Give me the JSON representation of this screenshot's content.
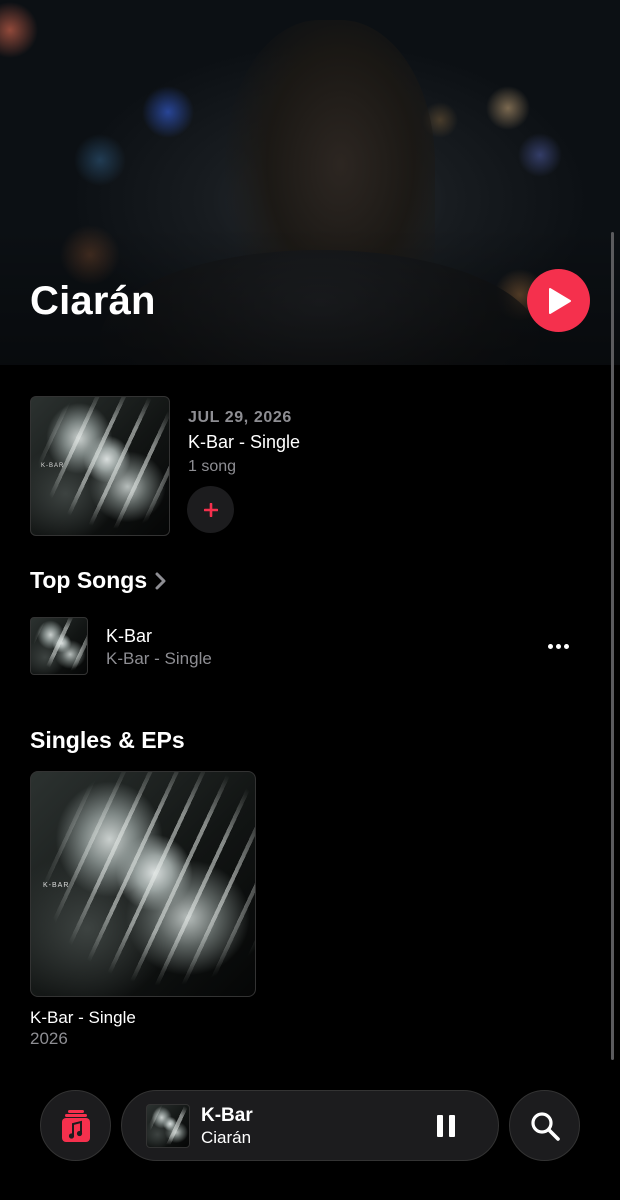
{
  "header": {
    "artist_name": "Ciarán",
    "play_icon": "play-icon",
    "accent_color": "#f5304d"
  },
  "latest_release": {
    "date": "JUL 29, 2026",
    "title": "K-Bar - Single",
    "song_count": "1 song",
    "add_icon": "plus-icon",
    "cover_text": "K-BAR"
  },
  "top_songs": {
    "heading": "Top Songs",
    "chevron_icon": "chevron-right-icon",
    "items": [
      {
        "title": "K-Bar",
        "subtitle": "K-Bar - Single",
        "more_icon": "ellipsis-icon"
      }
    ]
  },
  "singles": {
    "heading": "Singles & EPs",
    "items": [
      {
        "title": "K-Bar - Single",
        "year": "2026",
        "cover_text": "K-BAR"
      }
    ]
  },
  "mini_player": {
    "title": "K-Bar",
    "artist": "Ciarán",
    "pause_icon": "pause-icon"
  },
  "tabs": {
    "music_icon": "music-note-icon",
    "search_icon": "search-icon"
  }
}
